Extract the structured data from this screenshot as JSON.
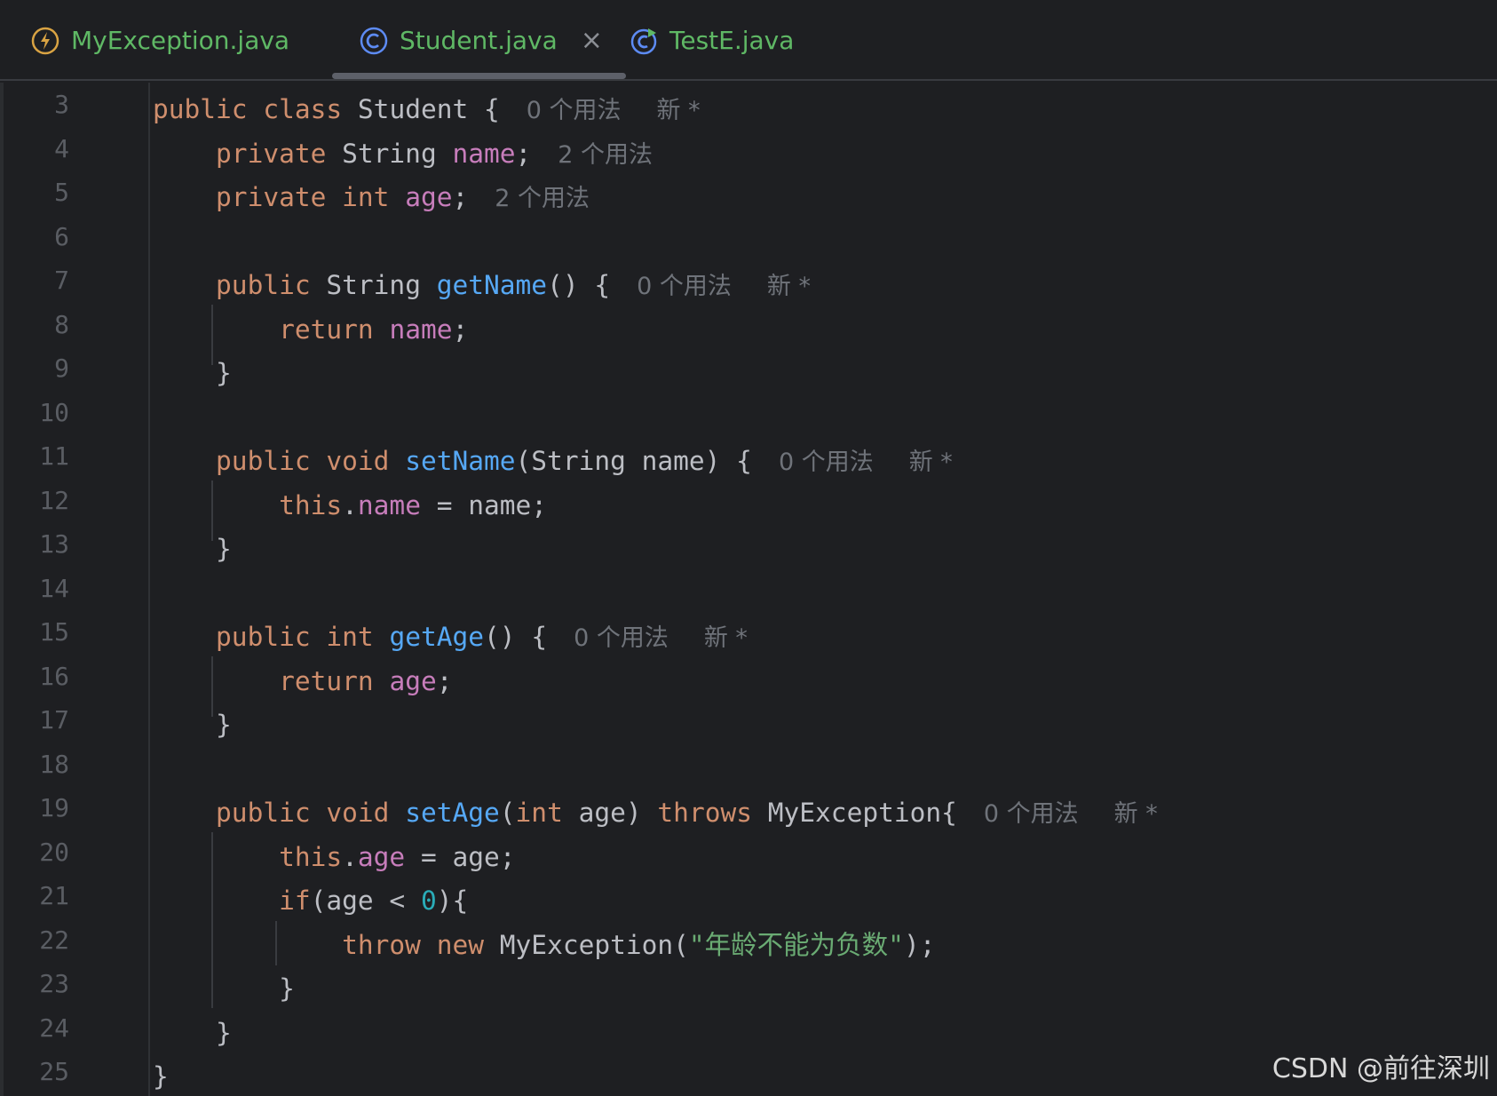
{
  "tabs": [
    {
      "label": "MyException.java",
      "icon": "exception-class-icon",
      "active": false
    },
    {
      "label": "Student.java",
      "icon": "class-icon",
      "active": true
    },
    {
      "label": "TestE.java",
      "icon": "runnable-class-icon",
      "active": false
    }
  ],
  "close_glyph": "×",
  "hints": {
    "usages0": "0 个用法",
    "usages2": "2 个用法",
    "new": "新 *"
  },
  "line_numbers": [
    "3",
    "4",
    "5",
    "6",
    "7",
    "8",
    "9",
    "10",
    "11",
    "12",
    "13",
    "14",
    "15",
    "16",
    "17",
    "18",
    "19",
    "20",
    "21",
    "22",
    "23",
    "24",
    "25"
  ],
  "code": {
    "l3": {
      "public": "public",
      "class": "class",
      "name": "Student",
      "brace": "{"
    },
    "l4": {
      "private": "private",
      "type": "String",
      "field": "name",
      "semi": ";"
    },
    "l5": {
      "private": "private",
      "type": "int",
      "field": "age",
      "semi": ";"
    },
    "l7": {
      "public": "public",
      "type": "String",
      "method": "getName",
      "rest": "() {"
    },
    "l8": {
      "return": "return",
      "field": "name",
      "semi": ";"
    },
    "l11": {
      "public": "public",
      "void": "void",
      "method": "setName",
      "params": "(String name) {"
    },
    "l12": {
      "this": "this",
      "dot": ".",
      "field": "name",
      "rest": " = name;"
    },
    "l15": {
      "public": "public",
      "type": "int",
      "method": "getAge",
      "rest": "() {"
    },
    "l16": {
      "return": "return",
      "field": "age",
      "semi": ";"
    },
    "l19": {
      "public": "public",
      "void": "void",
      "method": "setAge",
      "paren_open": "(",
      "int": "int",
      "param": " age) ",
      "throws": "throws",
      "exc": "MyException{"
    },
    "l20": {
      "this": "this",
      "dot": ".",
      "field": "age",
      "rest": " = age;"
    },
    "l21": {
      "if": "if",
      "cond": "(age < ",
      "zero": "0",
      "close": "){"
    },
    "l22": {
      "throw": "throw",
      "new": "new",
      "ctor": "MyException(",
      "str": "\"年龄不能为负数\"",
      "end": ");"
    },
    "close_brace": "}"
  },
  "watermark": "CSDN @前往深圳",
  "colors": {
    "background": "#1e1f22",
    "keyword": "#cf8e6d",
    "method": "#56a8f5",
    "field": "#c77dbb",
    "number": "#2aacb8",
    "string": "#6aab73",
    "tab_text": "#5fb865"
  }
}
